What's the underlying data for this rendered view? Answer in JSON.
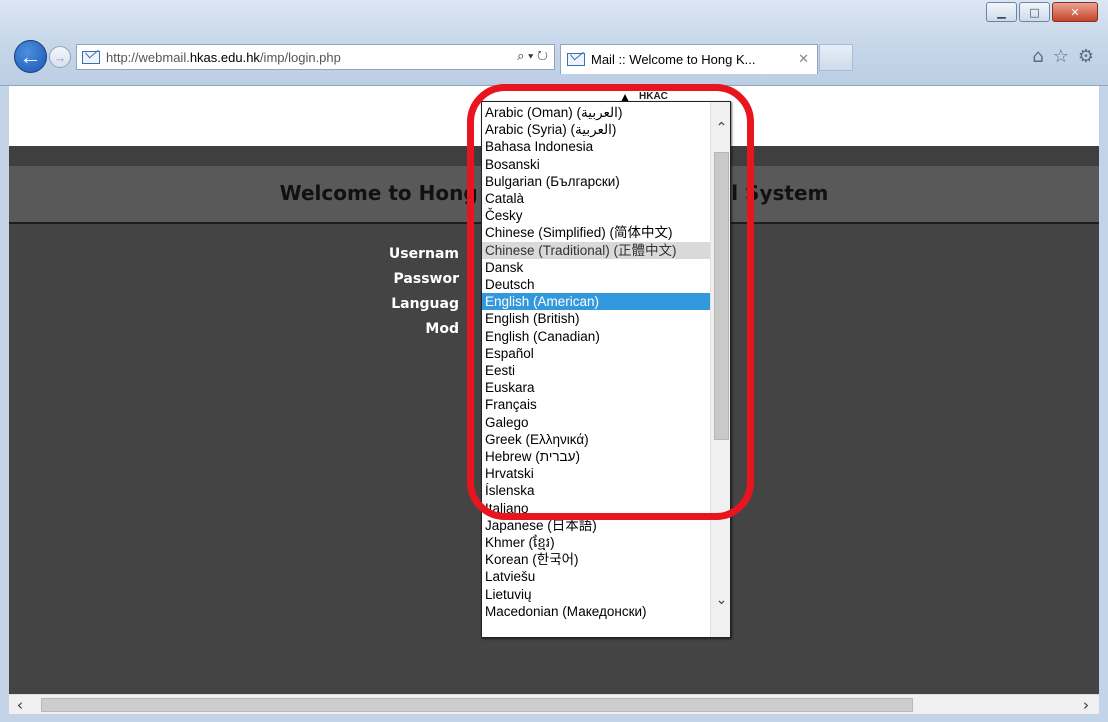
{
  "window": {
    "controls": {
      "minimize": "▁",
      "maximize": "□",
      "close": "✕"
    }
  },
  "nav": {
    "back_icon": "arrow-left",
    "forward_icon": "arrow-right"
  },
  "address_bar": {
    "url_prefix": "http://webmail.",
    "url_domain": "hkas.edu.hk",
    "url_suffix": "/imp/login.php",
    "tools": "⌕ ▾ ↻"
  },
  "tab": {
    "title": "Mail :: Welcome to Hong K...",
    "close": "✕"
  },
  "browser_icons": {
    "home": "⌂",
    "favorites": "☆",
    "settings": "⚙"
  },
  "page": {
    "logo_text": "HKAC",
    "welcome_visible_left": "Welcome to Hong ",
    "welcome_visible_right": "nail System",
    "form_labels": {
      "username": "Usernam",
      "password": "Passwor",
      "language": "Languag",
      "mode": "Mod"
    }
  },
  "language_dropdown": {
    "selected": "English (American)",
    "hovered": "Chinese (Traditional) (正體中文)",
    "options": [
      "Arabic (Oman) (العربية)",
      "Arabic (Syria) (العربية)",
      "Bahasa Indonesia",
      "Bosanski",
      "Bulgarian (Български)",
      "Català",
      "Česky",
      "Chinese (Simplified) (简体中文)",
      "Chinese (Traditional) (正體中文)",
      "Dansk",
      "Deutsch",
      "English (American)",
      "English (British)",
      "English (Canadian)",
      "Español",
      "Eesti",
      "Euskara",
      "Français",
      "Galego",
      "Greek (Ελληνικά)",
      "Hebrew (עברית)",
      "Hrvatski",
      "Íslenska",
      "Italiano",
      "Japanese (日本語)",
      "Khmer (ខ្មែរ)",
      "Korean (한국어)",
      "Latviešu",
      "Lietuvių",
      "Macedonian (Македонски)"
    ]
  },
  "colors": {
    "highlight": "#e8141e",
    "selected": "#3399dd",
    "page_bg": "#444444"
  }
}
